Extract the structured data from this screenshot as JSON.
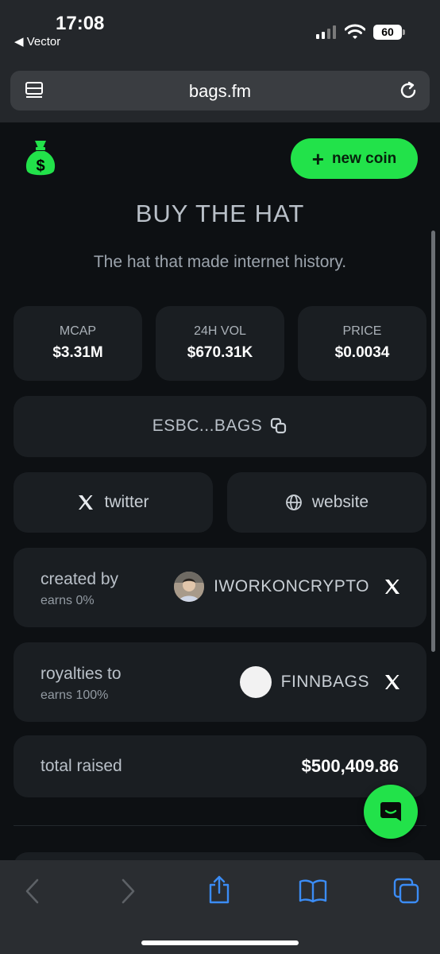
{
  "status_bar": {
    "time": "17:08",
    "back_app": "Vector",
    "battery": "60"
  },
  "browser": {
    "url": "bags.fm"
  },
  "header": {
    "new_coin_label": "new coin",
    "new_coin_icon": "plus-icon"
  },
  "coin": {
    "title": "BUY THE HAT",
    "description": "The hat that made internet history."
  },
  "stats": [
    {
      "label": "MCAP",
      "value": "$3.31M"
    },
    {
      "label": "24H VOL",
      "value": "$670.31K"
    },
    {
      "label": "PRICE",
      "value": "$0.0034"
    }
  ],
  "address": {
    "short": "ESBC...BAGS"
  },
  "links": {
    "twitter": "twitter",
    "website": "website"
  },
  "creator": {
    "title": "created by",
    "earns": "earns 0%",
    "name": "IWORKONCRYPTO"
  },
  "royalties": {
    "title": "royalties to",
    "earns": "earns 100%",
    "name": "FINNBAGS"
  },
  "raised": {
    "label": "total raised",
    "value": "$500,409.86"
  },
  "colors": {
    "accent": "#22e24a",
    "background": "#0d1013",
    "card": "#1a1e22"
  }
}
